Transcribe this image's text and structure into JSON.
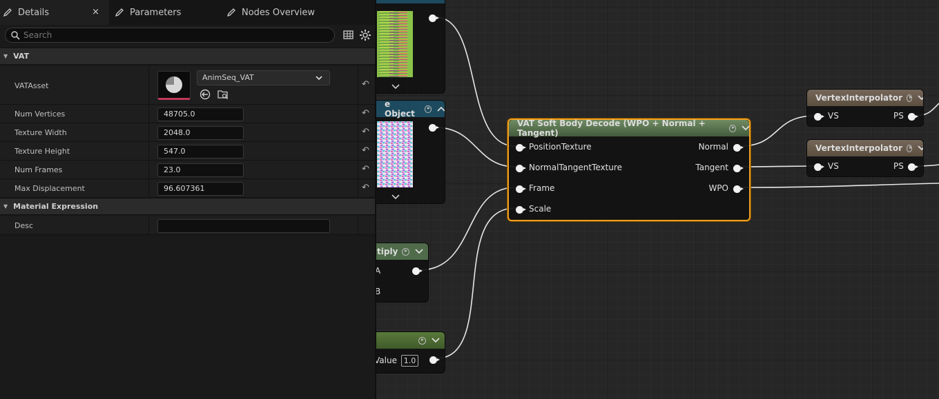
{
  "tabs": [
    {
      "label": "Details",
      "close": "×"
    },
    {
      "label": "Parameters"
    },
    {
      "label": "Nodes Overview"
    }
  ],
  "search": {
    "placeholder": "Search"
  },
  "categories": {
    "vat": "VAT",
    "material_expression": "Material Expression"
  },
  "properties": {
    "vat_asset": {
      "label": "VATAsset",
      "value": "AnimSeq_VAT"
    },
    "num_vertices": {
      "label": "Num Vertices",
      "value": "48705.0"
    },
    "texture_width": {
      "label": "Texture Width",
      "value": "2048.0"
    },
    "texture_height": {
      "label": "Texture Height",
      "value": "547.0"
    },
    "num_frames": {
      "label": "Num Frames",
      "value": "23.0"
    },
    "max_displacement": {
      "label": "Max Displacement",
      "value": "96.607361"
    },
    "desc": {
      "label": "Desc",
      "value": ""
    }
  },
  "graph": {
    "texture_node_1": {
      "title": "e Object"
    },
    "multiply_node": {
      "title": "tiply",
      "pin_a": "A",
      "pin_b": "B"
    },
    "scalar_node": {
      "title": "",
      "value_label": "Value",
      "value": "1.0"
    },
    "main_node": {
      "title": "VAT Soft Body Decode (WPO + Normal + Tangent)",
      "inputs": [
        "PositionTexture",
        "NormalTangentTexture",
        "Frame",
        "Scale"
      ],
      "outputs": [
        "Normal",
        "Tangent",
        "WPO"
      ]
    },
    "interp_1": {
      "title": "VertexInterpolator",
      "in": "VS",
      "out": "PS"
    },
    "interp_2": {
      "title": "VertexInterpolator",
      "in": "VS",
      "out": "PS"
    }
  },
  "colors": {
    "texture_header": "#1d4a5e",
    "function_header": "#4f6b4a",
    "interp_header": "#5b4e3f",
    "selection": "#f0a020",
    "accent_pink": "#c0395a"
  },
  "icons": [
    "pencil-icon",
    "close-icon",
    "search-icon",
    "table-icon",
    "settings-icon",
    "reset-arrow-icon",
    "browse-icon",
    "find-in-browser-icon",
    "chevron-down-icon"
  ]
}
